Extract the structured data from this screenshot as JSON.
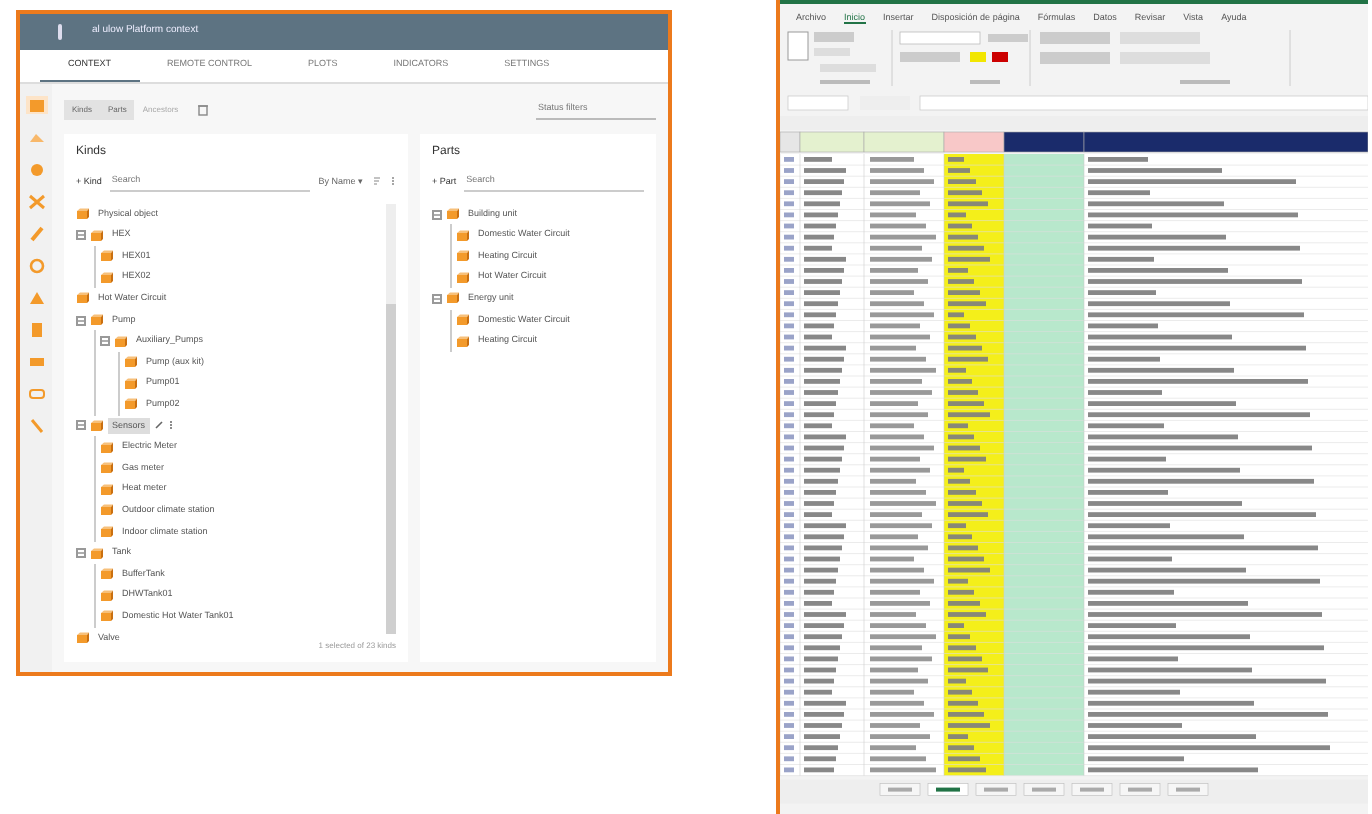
{
  "app": {
    "title": "al ulow Platform context",
    "tabs": [
      {
        "label": "CONTEXT",
        "selected": true
      },
      {
        "label": "REMOTE CONTROL",
        "selected": false
      },
      {
        "label": "PLOTS",
        "selected": false
      },
      {
        "label": "INDICATORS",
        "selected": false
      },
      {
        "label": "SETTINGS",
        "selected": false
      }
    ],
    "rail": [
      {
        "selected": true
      },
      {
        "selected": false
      },
      {
        "selected": false
      },
      {
        "selected": false
      },
      {
        "selected": false
      },
      {
        "selected": false
      },
      {
        "selected": false
      },
      {
        "selected": false
      },
      {
        "selected": false
      },
      {
        "selected": false
      },
      {
        "selected": false
      }
    ],
    "view_buttons": [
      {
        "label": "Kinds",
        "selected": true
      },
      {
        "label": "Parts",
        "selected": true
      },
      {
        "label": "Ancestors",
        "selected": false
      }
    ],
    "status_filter": {
      "placeholder": "Status filters"
    },
    "kinds": {
      "title": "Kinds",
      "add": "+ Kind",
      "search": {
        "placeholder": "Search"
      },
      "sort": "By Name ▾",
      "footer": "1 selected of 23 kinds",
      "items": [
        {
          "label": "Physical object",
          "selected": false
        },
        {
          "label": "HEX",
          "expanded": true,
          "selected": false,
          "children": [
            {
              "label": "HEX01",
              "selected": false
            },
            {
              "label": "HEX02",
              "selected": false
            }
          ]
        },
        {
          "label": "Hot Water Circuit",
          "selected": false
        },
        {
          "label": "Pump",
          "expanded": true,
          "selected": false,
          "children": [
            {
              "label": "Auxiliary_Pumps",
              "expanded": true,
              "selected": false,
              "children": [
                {
                  "label": "Pump (aux kit)",
                  "selected": false
                },
                {
                  "label": "Pump01",
                  "selected": false
                },
                {
                  "label": "Pump02",
                  "selected": false
                }
              ]
            }
          ]
        },
        {
          "label": "Sensors",
          "expanded": true,
          "selected": true,
          "children": [
            {
              "label": "Electric Meter",
              "selected": false
            },
            {
              "label": "Gas meter",
              "selected": false
            },
            {
              "label": "Heat meter",
              "selected": false
            },
            {
              "label": "Outdoor climate station",
              "selected": false
            },
            {
              "label": "Indoor climate station",
              "selected": false
            }
          ]
        },
        {
          "label": "Tank",
          "expanded": true,
          "selected": false,
          "children": [
            {
              "label": "BufferTank",
              "selected": false
            },
            {
              "label": "DHWTank01",
              "selected": false
            },
            {
              "label": "Domestic Hot Water Tank01",
              "selected": false
            }
          ]
        },
        {
          "label": "Valve",
          "selected": false
        }
      ]
    },
    "parts": {
      "title": "Parts",
      "add": "+ Part",
      "search": {
        "placeholder": "Search"
      },
      "items": [
        {
          "label": "Building unit",
          "expanded": true,
          "selected": false,
          "children": [
            {
              "label": "Domestic Water Circuit",
              "selected": false
            },
            {
              "label": "Heating Circuit",
              "selected": false
            },
            {
              "label": "Hot Water Circuit",
              "selected": false
            }
          ]
        },
        {
          "label": "Energy unit",
          "expanded": true,
          "selected": false,
          "children": [
            {
              "label": "Domestic Water Circuit",
              "selected": false
            },
            {
              "label": "Heating Circuit",
              "selected": false
            }
          ]
        }
      ]
    }
  },
  "sheet": {
    "ribbon_tabs": [
      {
        "label": "Archivo",
        "selected": false
      },
      {
        "label": "Inicio",
        "selected": true
      },
      {
        "label": "Insertar",
        "selected": false
      },
      {
        "label": "Disposición de página",
        "selected": false
      },
      {
        "label": "Fórmulas",
        "selected": false
      },
      {
        "label": "Datos",
        "selected": false
      },
      {
        "label": "Revisar",
        "selected": false
      },
      {
        "label": "Vista",
        "selected": false
      },
      {
        "label": "Ayuda",
        "selected": false
      }
    ]
  }
}
